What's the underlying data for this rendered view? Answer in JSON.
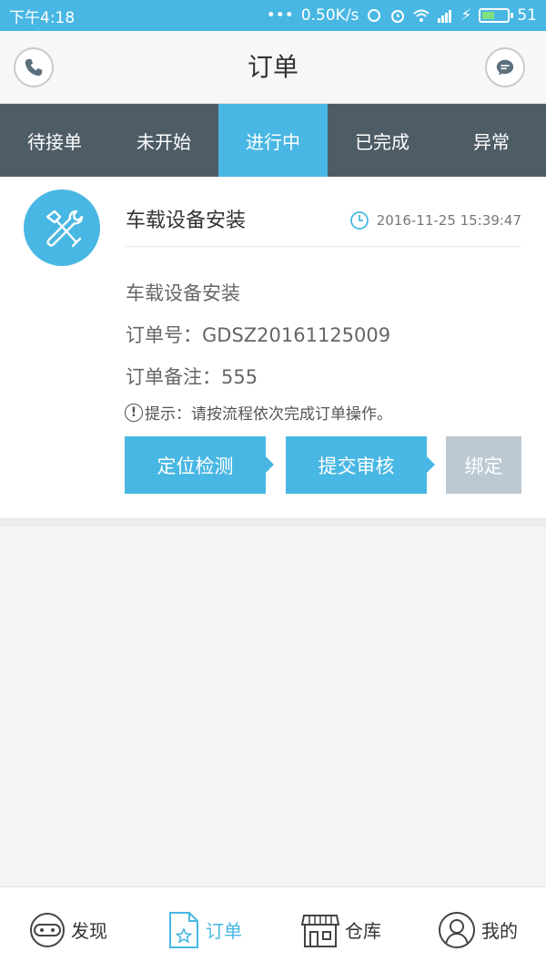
{
  "status_bar": {
    "time": "下午4:18",
    "net_speed": "0.50K/s",
    "battery": "51",
    "battery_level": 0.51
  },
  "header": {
    "title": "订单",
    "left_icon": "phone-icon",
    "right_icon": "message-icon"
  },
  "tabs": [
    {
      "label": "待接单",
      "active": false
    },
    {
      "label": "未开始",
      "active": false
    },
    {
      "label": "进行中",
      "active": true
    },
    {
      "label": "已完成",
      "active": false
    },
    {
      "label": "异常",
      "active": false
    }
  ],
  "order": {
    "icon": "tools-icon",
    "title": "车载设备安装",
    "time": "2016-11-25 15:39:47",
    "service_name": "车载设备安装",
    "order_no": "订单号：GDSZ20161125009",
    "remark": "订单备注：555",
    "tip": "提示：请按流程依次完成订单操作。",
    "steps": [
      {
        "label": "定位检测",
        "enabled": true
      },
      {
        "label": "提交审核",
        "enabled": true
      },
      {
        "label": "绑定",
        "enabled": false
      }
    ]
  },
  "bottom_nav": [
    {
      "label": "发现",
      "icon": "discover-icon",
      "active": false
    },
    {
      "label": "订单",
      "icon": "order-icon",
      "active": true
    },
    {
      "label": "仓库",
      "icon": "warehouse-icon",
      "active": false
    },
    {
      "label": "我的",
      "icon": "profile-icon",
      "active": false
    }
  ],
  "colors": {
    "accent": "#49b7e3",
    "tab_bar": "#4e5c66",
    "disabled": "#bcc9d2"
  }
}
